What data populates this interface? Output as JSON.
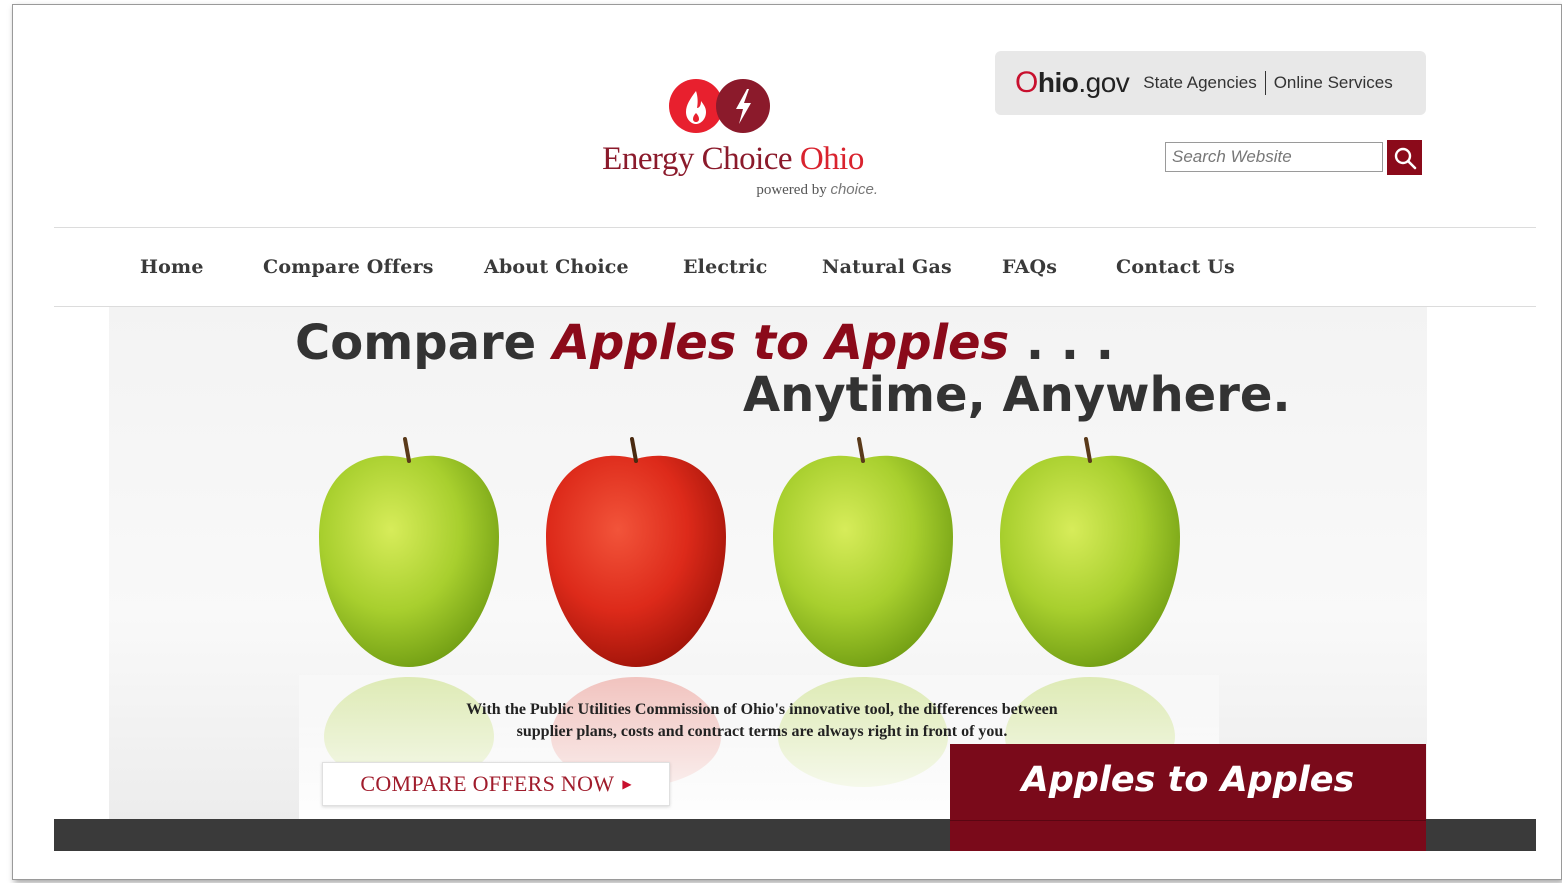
{
  "header": {
    "brand": {
      "title_main": "Energy Choice ",
      "title_accent": "Ohio",
      "powered_prefix": "powered by ",
      "powered_accent": "choice."
    },
    "gov_bar": {
      "logo_o": "O",
      "logo_hio": "hio",
      "logo_gov": ".gov",
      "links": [
        "State Agencies",
        "Online Services"
      ]
    },
    "search": {
      "placeholder": "Search Website"
    }
  },
  "nav": {
    "items": [
      "Home",
      "Compare Offers",
      "About Choice",
      "Electric",
      "Natural Gas",
      "FAQs",
      "Contact Us"
    ]
  },
  "hero": {
    "headline_pre": "Compare ",
    "headline_em": "Apples to Apples",
    "headline_post": " . . .",
    "headline_line2": "Anytime, Anywhere.",
    "caption_line1": "With the Public Utilities Commission of Ohio's innovative tool, the differences between",
    "caption_line2": "supplier plans, costs and contract terms are always right in front of you.",
    "cta_label": "COMPARE OFFERS NOW",
    "cta_arrow": "▶",
    "apples": [
      "green",
      "red",
      "green",
      "green"
    ]
  },
  "promo": {
    "title": "Apples to Apples"
  },
  "colors": {
    "brand_dark_red": "#8b0a1a",
    "brand_red": "#d9232e",
    "nav_text": "#3a3a3a",
    "dark_bar": "#3a3a3a"
  }
}
